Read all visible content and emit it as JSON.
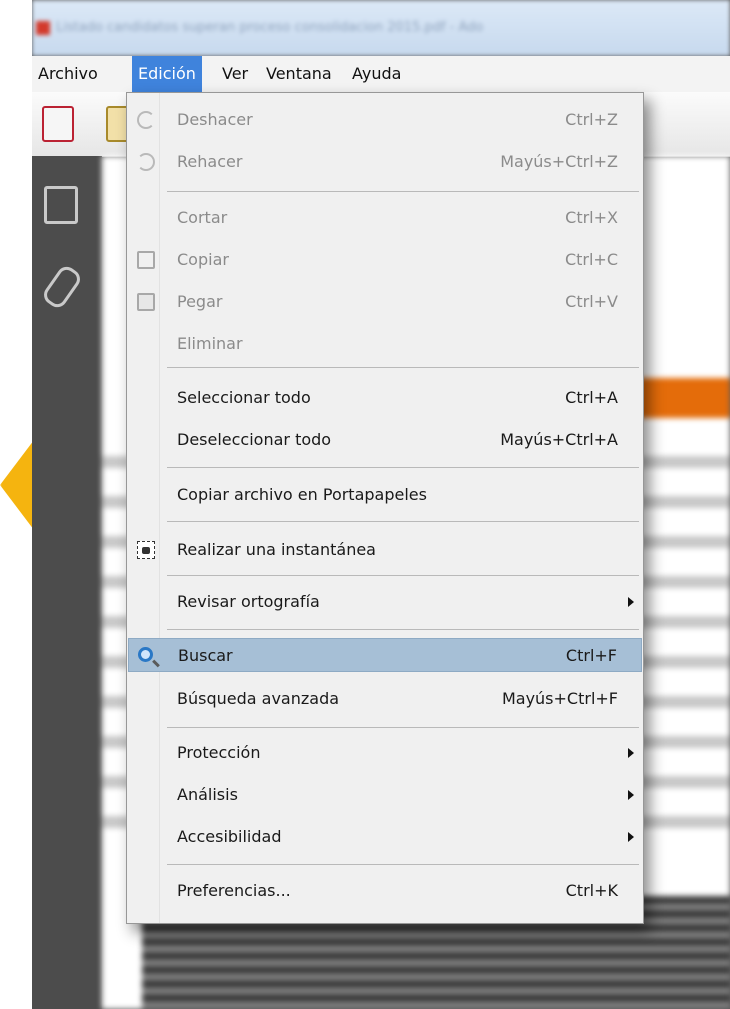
{
  "window": {
    "title": "Listado candidatos superan proceso consolidacion 2015.pdf - Ado"
  },
  "menubar": {
    "items": [
      "Archivo",
      "Edición",
      "Ver",
      "Ventana",
      "Ayuda"
    ],
    "active": "Edición"
  },
  "edit_menu": {
    "undo": {
      "label": "Deshacer",
      "shortcut": "Ctrl+Z"
    },
    "redo": {
      "label": "Rehacer",
      "shortcut": "Mayús+Ctrl+Z"
    },
    "cut": {
      "label": "Cortar",
      "shortcut": "Ctrl+X"
    },
    "copy": {
      "label": "Copiar",
      "shortcut": "Ctrl+C"
    },
    "paste": {
      "label": "Pegar",
      "shortcut": "Ctrl+V"
    },
    "delete": {
      "label": "Eliminar"
    },
    "select_all": {
      "label": "Seleccionar todo",
      "shortcut": "Ctrl+A"
    },
    "deselect_all": {
      "label": "Deseleccionar todo",
      "shortcut": "Mayús+Ctrl+A"
    },
    "copy_file": {
      "label": "Copiar archivo en Portapapeles"
    },
    "snapshot": {
      "label": "Realizar una instantánea"
    },
    "spelling": {
      "label": "Revisar ortografía"
    },
    "find": {
      "label": "Buscar",
      "shortcut": "Ctrl+F"
    },
    "advanced_search": {
      "label": "Búsqueda avanzada",
      "shortcut": "Mayús+Ctrl+F"
    },
    "protection": {
      "label": "Protección"
    },
    "analysis": {
      "label": "Análisis"
    },
    "accessibility": {
      "label": "Accesibilidad"
    },
    "preferences": {
      "label": "Preferencias...",
      "shortcut": "Ctrl+K"
    }
  },
  "icons": {
    "undo": "undo-icon",
    "redo": "redo-icon",
    "copy": "copy-icon",
    "paste": "paste-icon",
    "snapshot": "camera-icon",
    "find": "magnifier-icon"
  },
  "colors": {
    "menu_active": "#3f83dc",
    "highlight": "#a6bfd6",
    "disabled_text": "#8b8b8b"
  }
}
